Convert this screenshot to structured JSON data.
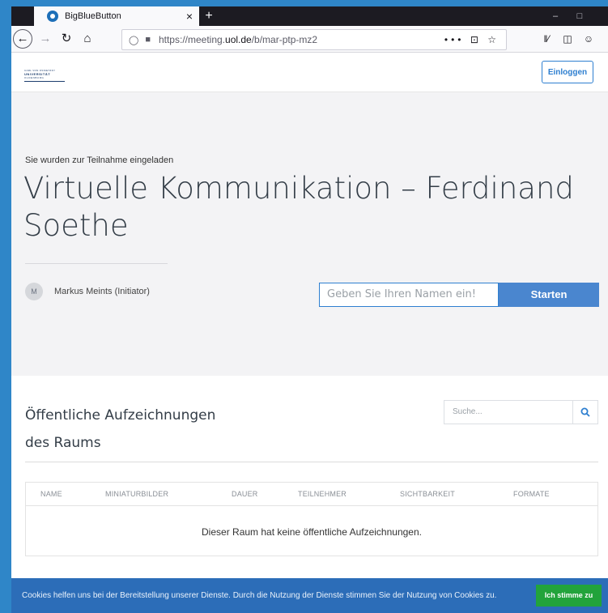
{
  "browser": {
    "tab_title": "BigBlueButton",
    "tab_close": "×",
    "new_tab": "+",
    "url_prefix": "https://meeting.",
    "url_domain": "uol.de",
    "url_path": "/b/mar-ptp-mz2",
    "url_actions": "••• ⊡ ☆",
    "controls": {
      "minimize": "–",
      "maximize": "□"
    }
  },
  "header": {
    "logo_line1": "CARL VON OSSIETZKY",
    "logo_line2": "UNIVERSITÄT",
    "logo_line3": "OLDENBURG",
    "login_label": "Einloggen"
  },
  "invite": {
    "label": "Sie wurden zur Teilnahme eingeladen",
    "room_title": "Virtuelle Kommunikation – Ferdinand Soethe",
    "owner_initial": "M",
    "owner_name": "Markus Meints (Initiator)",
    "name_placeholder": "Geben Sie Ihren Namen ein!",
    "start_label": "Starten"
  },
  "recordings": {
    "title": "Öffentliche Aufzeichnungen des Raums",
    "search_placeholder": "Suche...",
    "columns": [
      "NAME",
      "MINIATURBILDER",
      "DAUER",
      "TEILNEHMER",
      "SICHTBARKEIT",
      "FORMATE"
    ],
    "empty_message": "Dieser Raum hat keine öffentliche Aufzeichnungen."
  },
  "cookies": {
    "text": "Cookies helfen uns bei der Bereitstellung unserer Dienste. Durch die Nutzung der Dienste stimmen Sie der Nutzung von Cookies zu.",
    "accept_label": "Ich stimme zu"
  }
}
